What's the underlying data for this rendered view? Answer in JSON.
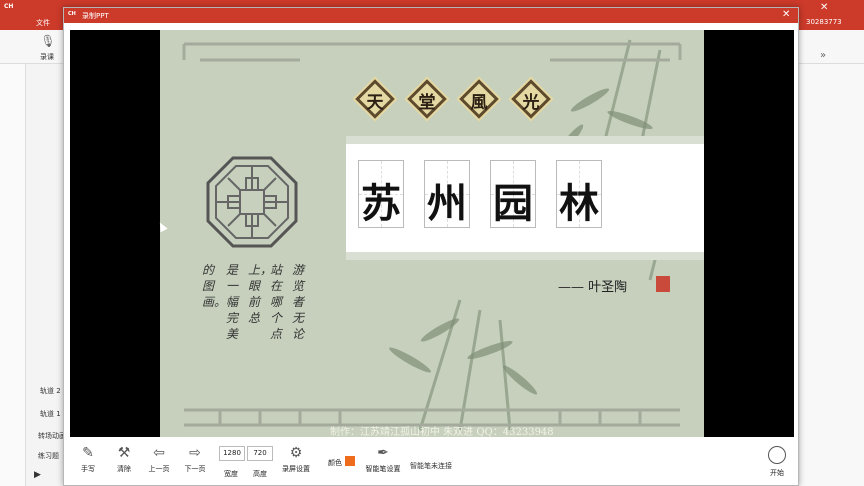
{
  "background_app": {
    "logo": "CH",
    "menu_file": "文件",
    "record_label": "录课",
    "code_fragment": "30283773",
    "track2": "轨道 2",
    "track1": "轨道 1",
    "anim_label": "转场动画",
    "practice_label": "练习题"
  },
  "dialog": {
    "logo": "CH",
    "title": "录制PPT"
  },
  "slide": {
    "medallions": [
      "天",
      "堂",
      "風",
      "光"
    ],
    "title_chars": [
      "苏",
      "州",
      "园",
      "林"
    ],
    "author": "—— 叶圣陶",
    "poem_columns": [
      "游览者无论",
      "站在哪个点",
      "上，眼前总",
      "是一幅完美",
      "的图画。"
    ],
    "footer": "制作：江苏靖江孤山初中    朱双进    QQ：43233948"
  },
  "controls": {
    "pen": "手写",
    "clear": "清除",
    "prev": "上一页",
    "next": "下一页",
    "width_value": "1280",
    "width_label": "宽度",
    "height_value": "720",
    "height_label": "高度",
    "record_settings": "录屏设置",
    "color_label": "颜色",
    "color_value": "#ef6c1c",
    "smart_pen_settings": "智能笔设置",
    "smart_pen_status": "智能笔未连接",
    "start": "开始"
  }
}
